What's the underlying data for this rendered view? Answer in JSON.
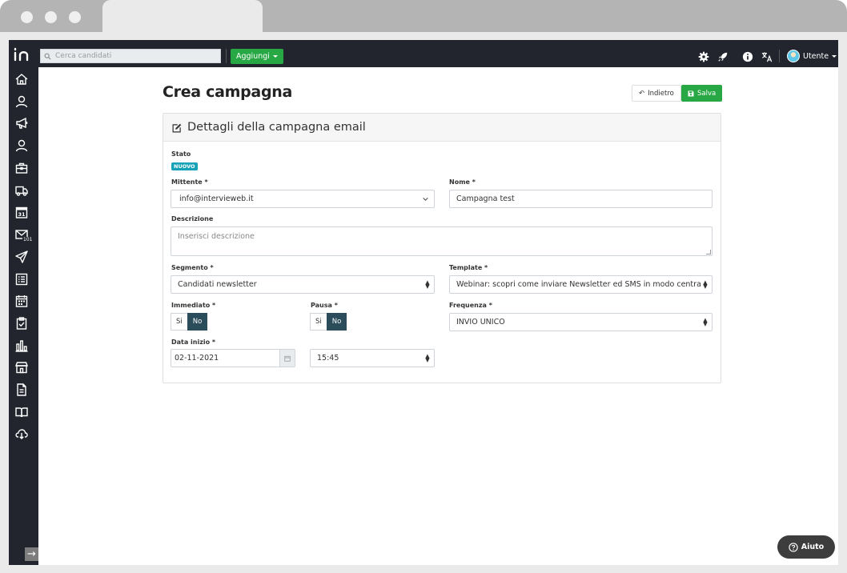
{
  "topbar": {
    "search_placeholder": "Cerca candidati",
    "add_label": "Aggiungi",
    "user_label": "Utente"
  },
  "sidebar": {
    "badge": "101"
  },
  "page": {
    "title": "Crea campagna",
    "back_label": "Indietro",
    "save_label": "Salva"
  },
  "card": {
    "title": "Dettagli della campagna email",
    "stato_label": "Stato",
    "stato_badge": "NUOVO",
    "mittente_label": "Mittente *",
    "mittente_value": "info@intervieweb.it",
    "nome_label": "Nome *",
    "nome_value": "Campagna test",
    "descrizione_label": "Descrizione",
    "descrizione_placeholder": "Inserisci descrizione",
    "segmento_label": "Segmento *",
    "segmento_value": "Candidati newsletter",
    "template_label": "Template *",
    "template_value": "Webinar: scopri come inviare Newsletter ed SMS in modo centralizzato",
    "immediato_label": "Immediato *",
    "pausa_label": "Pausa *",
    "toggle_si": "Si",
    "toggle_no": "No",
    "frequenza_label": "Frequenza *",
    "frequenza_value": "INVIO UNICO",
    "data_inizio_label": "Data inizio *",
    "data_inizio_value": "02-11-2021",
    "ora_value": "15:45"
  },
  "help": {
    "label": "Aiuto"
  },
  "colors": {
    "topbar": "#22252e",
    "accent_green": "#28a745",
    "badge_teal": "#17a2b8",
    "toggle_active": "#2b4c5a"
  }
}
